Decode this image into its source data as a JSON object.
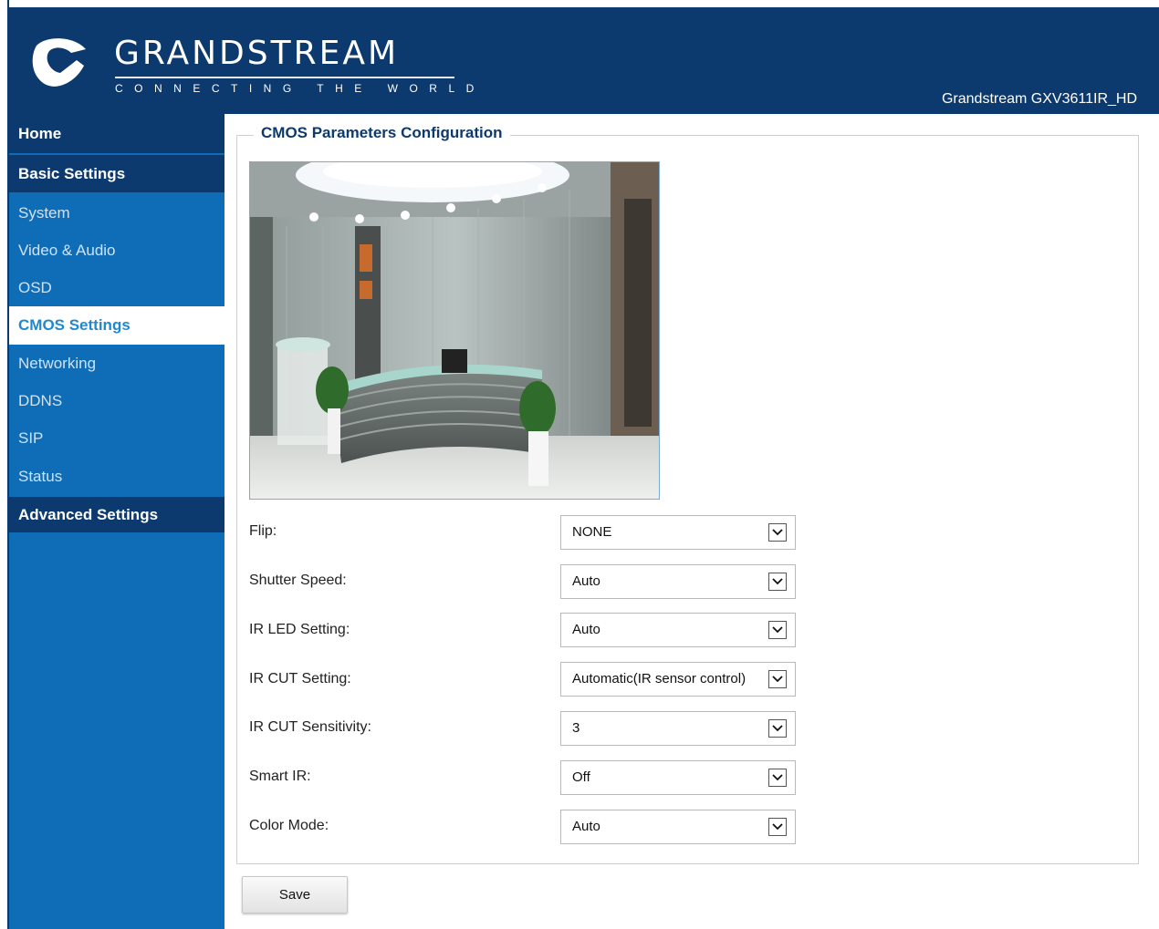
{
  "header": {
    "logo_word": "GRANDSTREAM",
    "logo_tagline": "CONNECTING THE WORLD",
    "model": "Grandstream GXV3611IR_HD"
  },
  "sidebar": {
    "items": [
      {
        "label": "Home",
        "kind": "head"
      },
      {
        "label": "Basic Settings",
        "kind": "head"
      },
      {
        "label": "System",
        "kind": "sub"
      },
      {
        "label": "Video & Audio",
        "kind": "sub"
      },
      {
        "label": "OSD",
        "kind": "sub"
      },
      {
        "label": "CMOS Settings",
        "kind": "active"
      },
      {
        "label": "Networking",
        "kind": "sub"
      },
      {
        "label": "DDNS",
        "kind": "sub"
      },
      {
        "label": "SIP",
        "kind": "sub"
      },
      {
        "label": "Status",
        "kind": "sub"
      },
      {
        "label": "Advanced Settings",
        "kind": "head"
      }
    ]
  },
  "main": {
    "section_title": "CMOS Parameters Configuration",
    "fields": [
      {
        "label": "Flip:",
        "value": "NONE"
      },
      {
        "label": "Shutter Speed:",
        "value": "Auto"
      },
      {
        "label": "IR LED Setting:",
        "value": "Auto"
      },
      {
        "label": "IR CUT Setting:",
        "value": "Automatic(IR sensor control)"
      },
      {
        "label": "IR CUT Sensitivity:",
        "value": "3"
      },
      {
        "label": "Smart IR:",
        "value": "Off"
      },
      {
        "label": "Color Mode:",
        "value": "Auto"
      }
    ],
    "save_label": "Save"
  },
  "colors": {
    "header_bg": "#0d3a6e",
    "sidebar_bg": "#0f6cb6",
    "active_text": "#1e88d1"
  }
}
